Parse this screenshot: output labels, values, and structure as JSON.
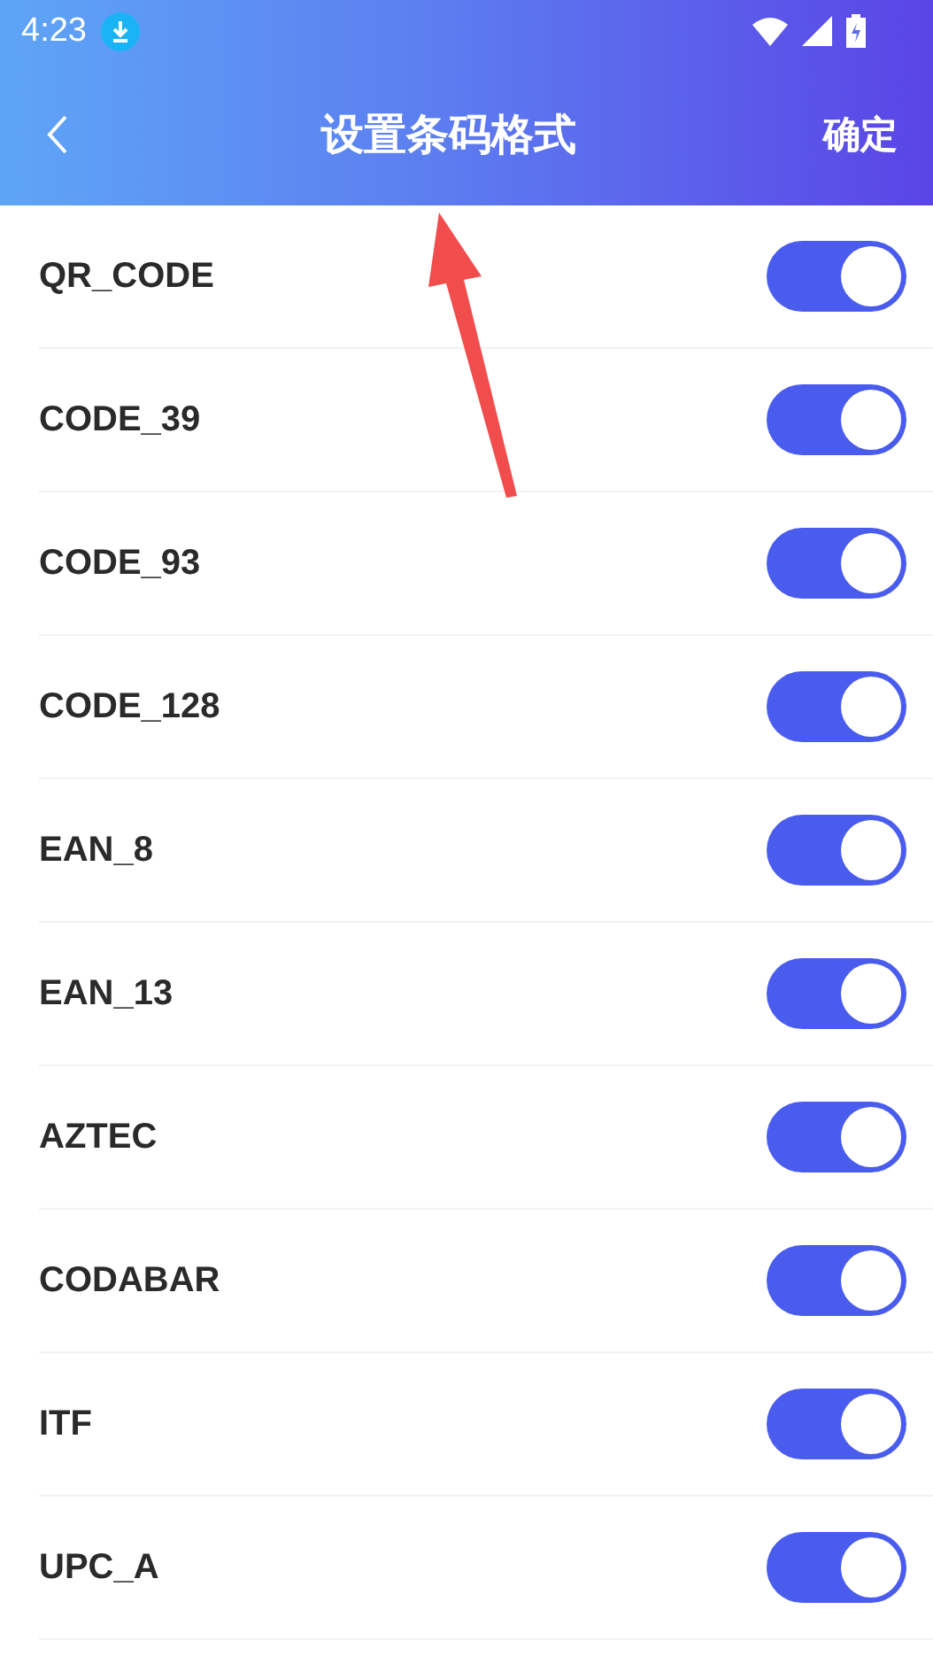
{
  "status_bar": {
    "time": "4:23"
  },
  "header": {
    "title": "设置条码格式",
    "action": "确定"
  },
  "formats": [
    {
      "label": "QR_CODE",
      "on": true
    },
    {
      "label": "CODE_39",
      "on": true
    },
    {
      "label": "CODE_93",
      "on": true
    },
    {
      "label": "CODE_128",
      "on": true
    },
    {
      "label": "EAN_8",
      "on": true
    },
    {
      "label": "EAN_13",
      "on": true
    },
    {
      "label": "AZTEC",
      "on": true
    },
    {
      "label": "CODABAR",
      "on": true
    },
    {
      "label": "ITF",
      "on": true
    },
    {
      "label": "UPC_A",
      "on": true
    }
  ]
}
